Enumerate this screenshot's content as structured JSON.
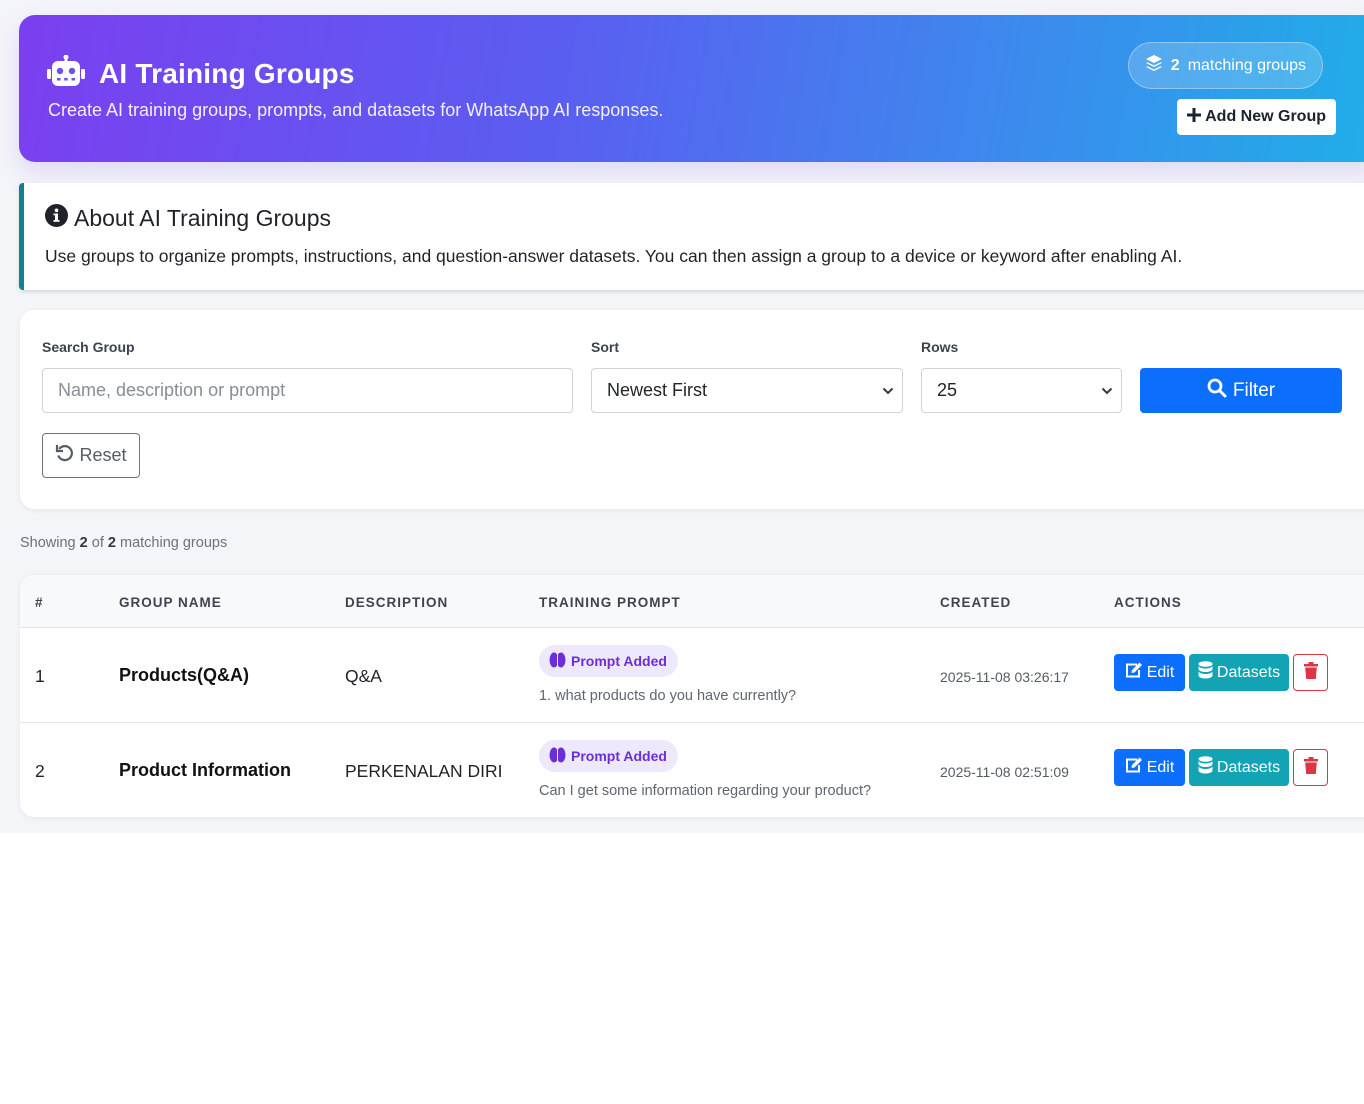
{
  "header": {
    "title": "AI Training Groups",
    "subtitle": "Create AI training groups, prompts, and datasets for WhatsApp AI responses.",
    "match_count": "2",
    "match_label": "matching groups",
    "add_button": "Add New Group"
  },
  "info": {
    "title": "About AI Training Groups",
    "text": "Use groups to organize prompts, instructions, and question-answer datasets. You can then assign a group to a device or keyword after enabling AI."
  },
  "filters": {
    "search_label": "Search Group",
    "search_placeholder": "Name, description or prompt",
    "sort_label": "Sort",
    "sort_value": "Newest First",
    "rows_label": "Rows",
    "rows_value": "25",
    "filter_button": "Filter",
    "reset_button": "Reset"
  },
  "summary": {
    "prefix": "Showing",
    "shown": "2",
    "of": "of",
    "total": "2",
    "suffix": "matching groups"
  },
  "table": {
    "columns": [
      "#",
      "GROUP NAME",
      "DESCRIPTION",
      "TRAINING PROMPT",
      "CREATED",
      "ACTIONS"
    ],
    "rows": [
      {
        "index": "1",
        "name": "Products(Q&A)",
        "description": "Q&A",
        "badge": "Prompt Added",
        "prompt": "1. what products do you have currently?",
        "created": "2025-11-08 03:26:17",
        "edit": "Edit",
        "datasets": "Datasets"
      },
      {
        "index": "2",
        "name": "Product Information",
        "description": "PERKENALAN DIRI",
        "badge": "Prompt Added",
        "prompt": "Can I get some information regarding your product?",
        "created": "2025-11-08 02:51:09",
        "edit": "Edit",
        "datasets": "Datasets"
      }
    ]
  },
  "colors": {
    "primary": "#0b6efd",
    "info": "#12a3b5",
    "danger": "#dc3545",
    "badge_bg": "#eee8fd",
    "badge_text": "#6a2fd6",
    "hero_start": "#7b3ff0",
    "hero_end": "#20aee8"
  },
  "icons": {
    "hero": "robot-icon",
    "count": "layers-icon",
    "add": "plus-icon",
    "info": "info-circle-icon",
    "filter": "search-icon",
    "reset": "undo-icon",
    "badge": "brain-icon",
    "edit": "edit-icon",
    "datasets": "database-icon",
    "delete": "trash-icon"
  }
}
